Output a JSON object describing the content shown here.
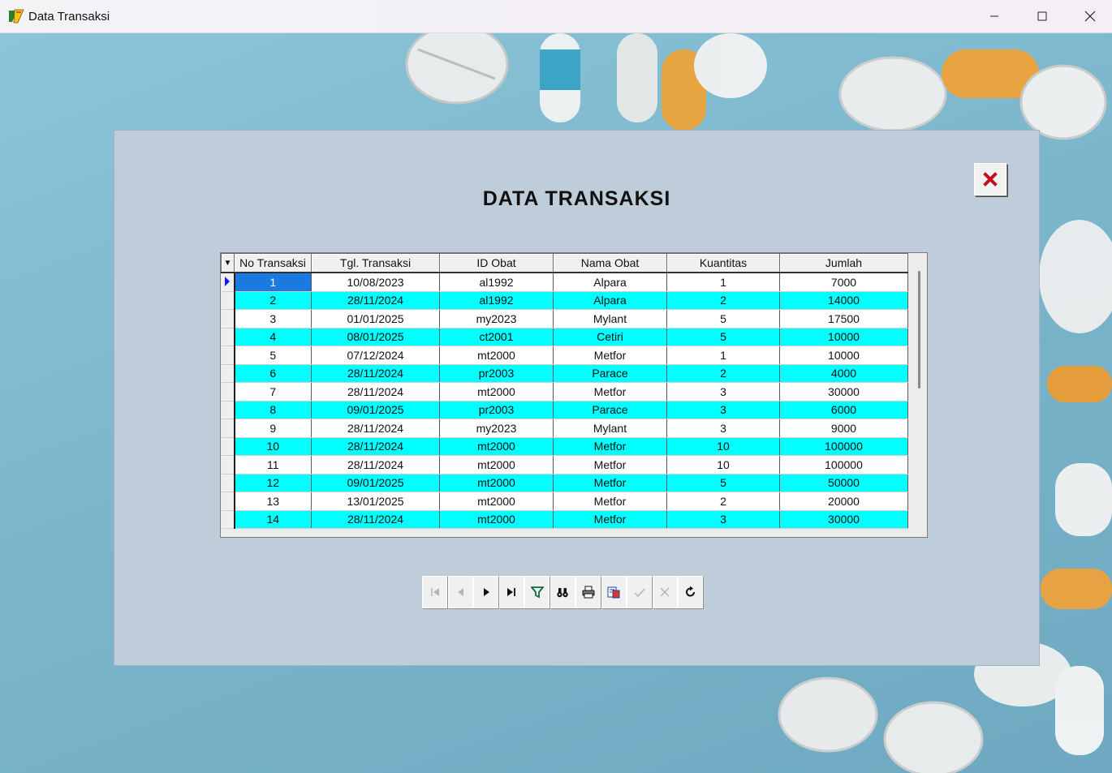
{
  "window": {
    "title": "Data Transaksi"
  },
  "panel": {
    "heading": "DATA TRANSAKSI"
  },
  "grid": {
    "columns": [
      "No Transaksi",
      "Tgl. Transaksi",
      "ID Obat",
      "Nama Obat",
      "Kuantitas",
      "Jumlah"
    ],
    "rows": [
      [
        "1",
        "10/08/2023",
        "al1992",
        "Alpara",
        "1",
        "7000"
      ],
      [
        "2",
        "28/11/2024",
        "al1992",
        "Alpara",
        "2",
        "14000"
      ],
      [
        "3",
        "01/01/2025",
        "my2023",
        "Mylant",
        "5",
        "17500"
      ],
      [
        "4",
        "08/01/2025",
        "ct2001",
        "Cetiri",
        "5",
        "10000"
      ],
      [
        "5",
        "07/12/2024",
        "mt2000",
        "Metfor",
        "1",
        "10000"
      ],
      [
        "6",
        "28/11/2024",
        "pr2003",
        "Parace",
        "2",
        "4000"
      ],
      [
        "7",
        "28/11/2024",
        "mt2000",
        "Metfor",
        "3",
        "30000"
      ],
      [
        "8",
        "09/01/2025",
        "pr2003",
        "Parace",
        "3",
        "6000"
      ],
      [
        "9",
        "28/11/2024",
        "my2023",
        "Mylant",
        "3",
        "9000"
      ],
      [
        "10",
        "28/11/2024",
        "mt2000",
        "Metfor",
        "10",
        "100000"
      ],
      [
        "11",
        "28/11/2024",
        "mt2000",
        "Metfor",
        "10",
        "100000"
      ],
      [
        "12",
        "09/01/2025",
        "mt2000",
        "Metfor",
        "5",
        "50000"
      ],
      [
        "13",
        "13/01/2025",
        "mt2000",
        "Metfor",
        "2",
        "20000"
      ],
      [
        "14",
        "28/11/2024",
        "mt2000",
        "Metfor",
        "3",
        "30000"
      ]
    ],
    "selected_row": 0,
    "row_colors": {
      "odd": "#ffffff",
      "even": "#00ffff"
    }
  },
  "navigator": {
    "buttons": [
      {
        "name": "first-record",
        "icon": "first-icon",
        "enabled": false
      },
      {
        "name": "prior-record",
        "icon": "prior-icon",
        "enabled": false
      },
      {
        "name": "next-record",
        "icon": "next-icon",
        "enabled": true
      },
      {
        "name": "last-record",
        "icon": "last-icon",
        "enabled": true
      },
      {
        "name": "filter",
        "icon": "filter-icon",
        "enabled": true
      },
      {
        "name": "find",
        "icon": "binoculars-icon",
        "enabled": true
      },
      {
        "name": "print",
        "icon": "printer-icon",
        "enabled": true
      },
      {
        "name": "export",
        "icon": "export-icon",
        "enabled": true
      },
      {
        "name": "post",
        "icon": "check-icon",
        "enabled": false
      },
      {
        "name": "cancel",
        "icon": "cancel-icon",
        "enabled": false
      },
      {
        "name": "refresh",
        "icon": "refresh-icon",
        "enabled": true
      }
    ]
  }
}
